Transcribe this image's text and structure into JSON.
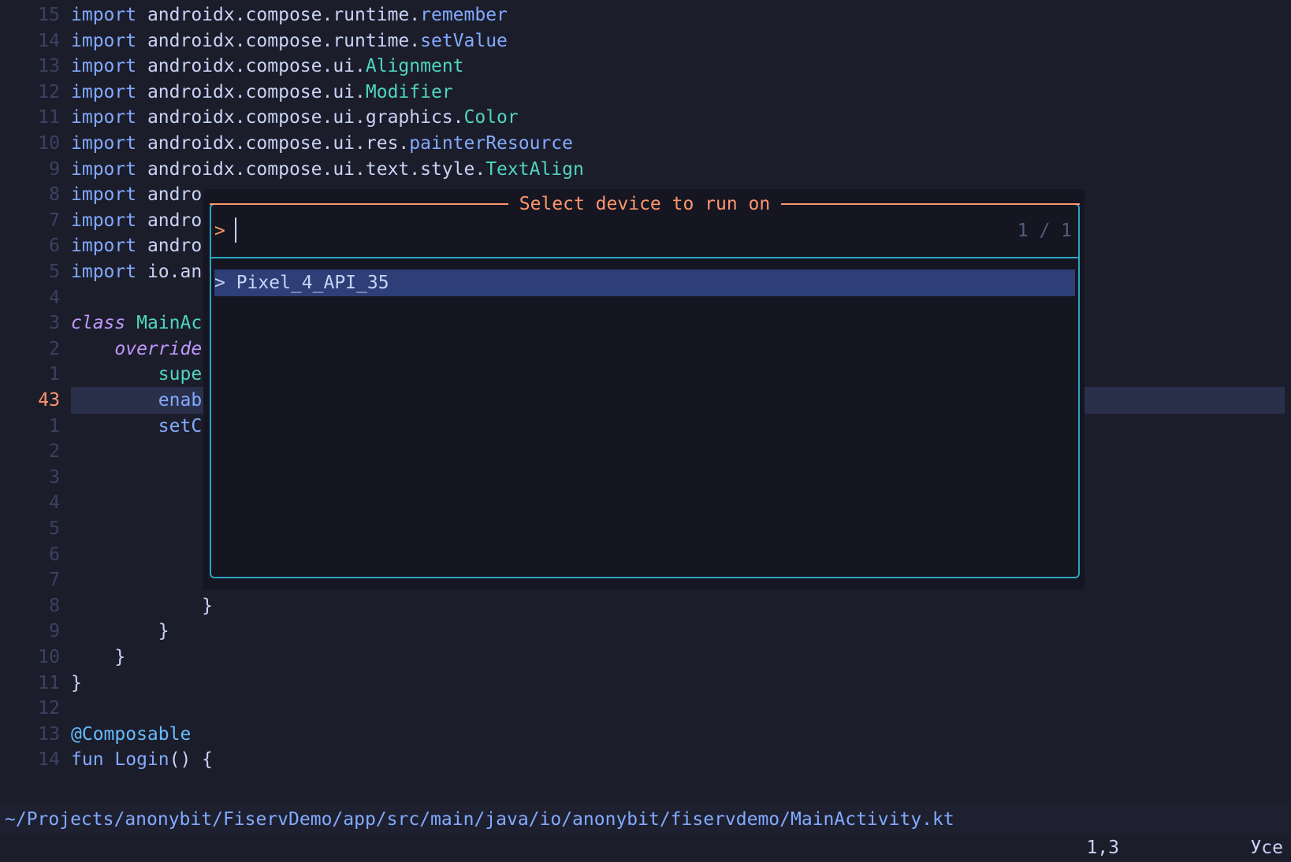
{
  "editor": {
    "lines": [
      {
        "num": "15",
        "tokens": [
          {
            "t": "import ",
            "c": "kw"
          },
          {
            "t": "androidx.compose.runtime.",
            "c": "punc"
          },
          {
            "t": "remember",
            "c": "fn"
          }
        ]
      },
      {
        "num": "14",
        "tokens": [
          {
            "t": "import ",
            "c": "kw"
          },
          {
            "t": "androidx.compose.runtime.",
            "c": "punc"
          },
          {
            "t": "setValue",
            "c": "fn"
          }
        ]
      },
      {
        "num": "13",
        "tokens": [
          {
            "t": "import ",
            "c": "kw"
          },
          {
            "t": "androidx.compose.ui.",
            "c": "punc"
          },
          {
            "t": "Alignment",
            "c": "cls"
          }
        ]
      },
      {
        "num": "12",
        "tokens": [
          {
            "t": "import ",
            "c": "kw"
          },
          {
            "t": "androidx.compose.ui.",
            "c": "punc"
          },
          {
            "t": "Modifier",
            "c": "cls"
          }
        ]
      },
      {
        "num": "11",
        "tokens": [
          {
            "t": "import ",
            "c": "kw"
          },
          {
            "t": "androidx.compose.ui.graphics.",
            "c": "punc"
          },
          {
            "t": "Color",
            "c": "cls"
          }
        ]
      },
      {
        "num": "10",
        "tokens": [
          {
            "t": "import ",
            "c": "kw"
          },
          {
            "t": "androidx.compose.ui.res.",
            "c": "punc"
          },
          {
            "t": "painterResource",
            "c": "fn"
          }
        ]
      },
      {
        "num": "9",
        "tokens": [
          {
            "t": "import ",
            "c": "kw"
          },
          {
            "t": "androidx.compose.ui.text.style.",
            "c": "punc"
          },
          {
            "t": "TextAlign",
            "c": "cls"
          }
        ]
      },
      {
        "num": "8",
        "tokens": [
          {
            "t": "import ",
            "c": "kw"
          },
          {
            "t": "andro",
            "c": "punc"
          }
        ]
      },
      {
        "num": "7",
        "tokens": [
          {
            "t": "import ",
            "c": "kw"
          },
          {
            "t": "andro",
            "c": "punc"
          }
        ]
      },
      {
        "num": "6",
        "tokens": [
          {
            "t": "import ",
            "c": "kw"
          },
          {
            "t": "andro",
            "c": "punc"
          }
        ]
      },
      {
        "num": "5",
        "tokens": [
          {
            "t": "import ",
            "c": "kw"
          },
          {
            "t": "io.an",
            "c": "punc"
          }
        ]
      },
      {
        "num": "4",
        "tokens": []
      },
      {
        "num": "3",
        "tokens": [
          {
            "t": "class ",
            "c": "it"
          },
          {
            "t": "MainAc",
            "c": "cls"
          }
        ]
      },
      {
        "num": "2",
        "tokens": [
          {
            "t": "    override",
            "c": "it"
          }
        ]
      },
      {
        "num": "1",
        "tokens": [
          {
            "t": "        supe",
            "c": "cls"
          }
        ]
      },
      {
        "num": "43",
        "current": true,
        "tokens": [
          {
            "t": "        enab",
            "c": "fn"
          }
        ]
      },
      {
        "num": "1",
        "tokens": [
          {
            "t": "        setC",
            "c": "fn"
          }
        ]
      },
      {
        "num": "2",
        "tokens": []
      },
      {
        "num": "3",
        "tokens": []
      },
      {
        "num": "4",
        "tokens": []
      },
      {
        "num": "5",
        "tokens": []
      },
      {
        "num": "6",
        "tokens": []
      },
      {
        "num": "7",
        "tokens": [
          {
            "t": "                }",
            "c": "punc"
          }
        ]
      },
      {
        "num": "8",
        "tokens": [
          {
            "t": "            }",
            "c": "punc"
          }
        ]
      },
      {
        "num": "9",
        "tokens": [
          {
            "t": "        }",
            "c": "punc"
          }
        ]
      },
      {
        "num": "10",
        "tokens": [
          {
            "t": "    }",
            "c": "punc"
          }
        ]
      },
      {
        "num": "11",
        "tokens": [
          {
            "t": "}",
            "c": "punc"
          }
        ]
      },
      {
        "num": "12",
        "tokens": []
      },
      {
        "num": "13",
        "tokens": [
          {
            "t": "@Composable",
            "c": "ann"
          }
        ]
      },
      {
        "num": "14",
        "tokens": [
          {
            "t": "fun ",
            "c": "kw"
          },
          {
            "t": "Login",
            "c": "fn"
          },
          {
            "t": "() {",
            "c": "punc"
          }
        ]
      }
    ]
  },
  "picker": {
    "title": "Select device to run on",
    "prompt": ">",
    "counter": "1 / 1",
    "results": [
      "> Pixel_4_API_35"
    ]
  },
  "statusbar": {
    "path": "~/Projects/anonybit/FiservDemo/app/src/main/java/io/anonybit/fiservdemo/MainActivity.kt"
  },
  "cmdline": {
    "position": "1,3",
    "scroll": "Усе"
  },
  "colors": {
    "background": "#1c1d2b",
    "accent_orange": "#ff966c",
    "accent_cyan": "#2aa6c0",
    "selection": "#2d3f76"
  }
}
